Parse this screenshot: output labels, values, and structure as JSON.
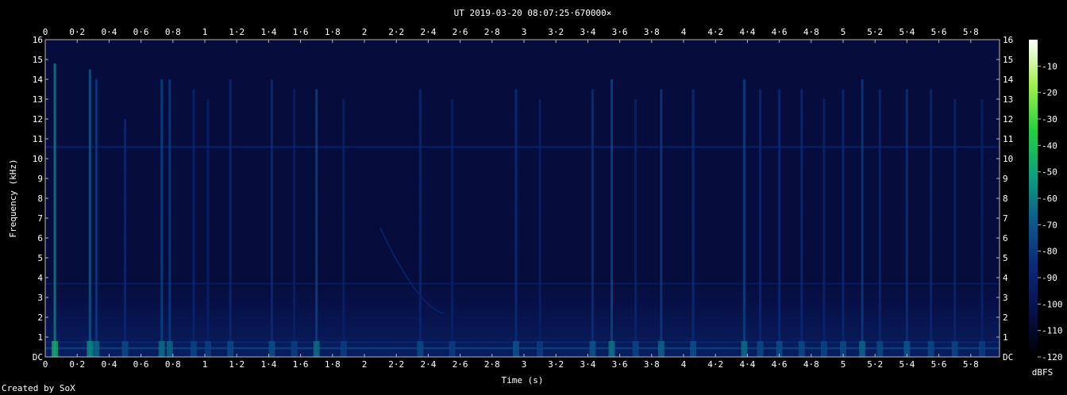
{
  "chart_data": {
    "type": "heatmap",
    "title": "UT 2019-03-20 08:07:25·670000×",
    "xlabel": "Time (s)",
    "ylabel": "Frequency (kHz)",
    "xlim": [
      0,
      5.98
    ],
    "ylim": [
      0,
      16
    ],
    "x_ticks": [
      "0",
      "0·2",
      "0·4",
      "0·6",
      "0·8",
      "1",
      "1·2",
      "1·4",
      "1·6",
      "1·8",
      "2",
      "2·2",
      "2·4",
      "2·6",
      "2·8",
      "3",
      "3·2",
      "3·4",
      "3·6",
      "3·8",
      "4",
      "4·2",
      "4·4",
      "4·6",
      "4·8",
      "5",
      "5·2",
      "5·4",
      "5·6",
      "5·8"
    ],
    "y_ticks": [
      "DC",
      "1",
      "2",
      "3",
      "4",
      "5",
      "6",
      "7",
      "8",
      "9",
      "10",
      "11",
      "12",
      "13",
      "14",
      "15",
      "16"
    ],
    "colorbar": {
      "label": "dBFS",
      "ticks": [
        "-10",
        "-20",
        "-30",
        "-40",
        "-50",
        "-60",
        "-70",
        "-80",
        "-90",
        "-100",
        "-110",
        "-120"
      ],
      "range": [
        -120,
        0
      ],
      "colors": [
        "#000000",
        "#07104a",
        "#0a2a78",
        "#0c5a8c",
        "#0fa080",
        "#23d040",
        "#a0f04a",
        "#ffffff"
      ]
    },
    "background_level_dbfs": -105,
    "horizontal_lines": [
      {
        "freq_khz": 10.6,
        "level_dbfs": -95
      },
      {
        "freq_khz": 3.7,
        "level_dbfs": -98
      },
      {
        "freq_khz": 0.45,
        "level_dbfs": -80
      },
      {
        "freq_khz": 0.75,
        "level_dbfs": -90
      }
    ],
    "transients": [
      {
        "time_s": 0.06,
        "top_khz": 14.8,
        "level_dbfs": -60
      },
      {
        "time_s": 0.28,
        "top_khz": 14.5,
        "level_dbfs": -70
      },
      {
        "time_s": 0.32,
        "top_khz": 14.0,
        "level_dbfs": -80
      },
      {
        "time_s": 0.5,
        "top_khz": 12.0,
        "level_dbfs": -88
      },
      {
        "time_s": 0.73,
        "top_khz": 14.0,
        "level_dbfs": -78
      },
      {
        "time_s": 0.78,
        "top_khz": 14.0,
        "level_dbfs": -80
      },
      {
        "time_s": 0.93,
        "top_khz": 13.5,
        "level_dbfs": -90
      },
      {
        "time_s": 1.02,
        "top_khz": 13.0,
        "level_dbfs": -92
      },
      {
        "time_s": 1.16,
        "top_khz": 14.0,
        "level_dbfs": -88
      },
      {
        "time_s": 1.42,
        "top_khz": 14.0,
        "level_dbfs": -86
      },
      {
        "time_s": 1.56,
        "top_khz": 13.5,
        "level_dbfs": -92
      },
      {
        "time_s": 1.7,
        "top_khz": 13.5,
        "level_dbfs": -78
      },
      {
        "time_s": 1.87,
        "top_khz": 13.0,
        "level_dbfs": -92
      },
      {
        "time_s": 2.35,
        "top_khz": 13.5,
        "level_dbfs": -88
      },
      {
        "time_s": 2.55,
        "top_khz": 13.0,
        "level_dbfs": -92
      },
      {
        "time_s": 2.95,
        "top_khz": 13.5,
        "level_dbfs": -85
      },
      {
        "time_s": 3.1,
        "top_khz": 13.0,
        "level_dbfs": -92
      },
      {
        "time_s": 3.43,
        "top_khz": 13.5,
        "level_dbfs": -84
      },
      {
        "time_s": 3.55,
        "top_khz": 14.0,
        "level_dbfs": -76
      },
      {
        "time_s": 3.7,
        "top_khz": 13.0,
        "level_dbfs": -90
      },
      {
        "time_s": 3.86,
        "top_khz": 13.5,
        "level_dbfs": -80
      },
      {
        "time_s": 4.06,
        "top_khz": 13.5,
        "level_dbfs": -86
      },
      {
        "time_s": 4.38,
        "top_khz": 14.0,
        "level_dbfs": -78
      },
      {
        "time_s": 4.48,
        "top_khz": 13.5,
        "level_dbfs": -88
      },
      {
        "time_s": 4.6,
        "top_khz": 13.5,
        "level_dbfs": -86
      },
      {
        "time_s": 4.74,
        "top_khz": 13.5,
        "level_dbfs": -88
      },
      {
        "time_s": 4.88,
        "top_khz": 13.0,
        "level_dbfs": -90
      },
      {
        "time_s": 5.0,
        "top_khz": 13.5,
        "level_dbfs": -88
      },
      {
        "time_s": 5.12,
        "top_khz": 14.0,
        "level_dbfs": -80
      },
      {
        "time_s": 5.23,
        "top_khz": 13.5,
        "level_dbfs": -88
      },
      {
        "time_s": 5.4,
        "top_khz": 13.5,
        "level_dbfs": -84
      },
      {
        "time_s": 5.55,
        "top_khz": 13.5,
        "level_dbfs": -88
      },
      {
        "time_s": 5.7,
        "top_khz": 13.0,
        "level_dbfs": -90
      },
      {
        "time_s": 5.87,
        "top_khz": 13.0,
        "level_dbfs": -92
      }
    ],
    "chirp": {
      "start_time_s": 2.1,
      "start_khz": 6.5,
      "end_time_s": 2.5,
      "end_khz": 2.2,
      "level_dbfs": -92
    }
  },
  "credit": "Created by SoX"
}
